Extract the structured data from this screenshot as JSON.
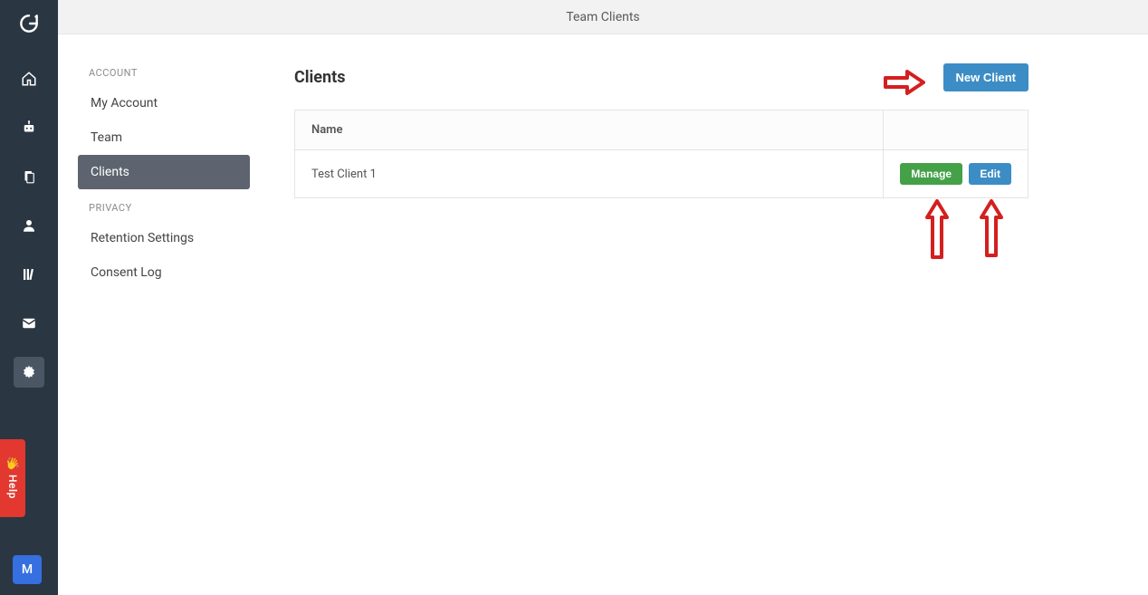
{
  "topbar": {
    "title": "Team Clients"
  },
  "rail": {
    "help_label": "Help",
    "avatar_letter": "M"
  },
  "sidebar": {
    "sections": [
      {
        "label": "ACCOUNT",
        "items": [
          {
            "label": "My Account",
            "active": false
          },
          {
            "label": "Team",
            "active": false
          },
          {
            "label": "Clients",
            "active": true
          }
        ]
      },
      {
        "label": "PRIVACY",
        "items": [
          {
            "label": "Retention Settings",
            "active": false
          },
          {
            "label": "Consent Log",
            "active": false
          }
        ]
      }
    ]
  },
  "main": {
    "heading": "Clients",
    "new_button": "New Client",
    "table": {
      "columns": [
        "Name",
        ""
      ],
      "rows": [
        {
          "name": "Test Client 1",
          "manage": "Manage",
          "edit": "Edit"
        }
      ]
    }
  },
  "colors": {
    "rail_bg": "#2b3643",
    "primary": "#3c8dc5",
    "success": "#44a147",
    "danger": "#e2382f"
  }
}
